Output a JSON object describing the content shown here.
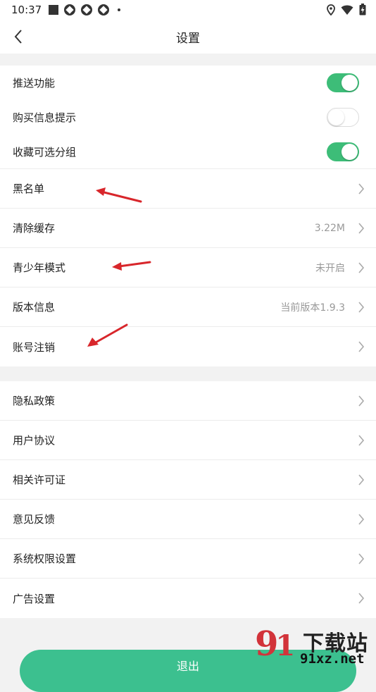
{
  "status_bar": {
    "time": "10:37",
    "icons_left": [
      "stop-square-icon",
      "app-icon",
      "app-icon",
      "app-icon",
      "dot-icon"
    ],
    "icons_right": [
      "location-icon",
      "wifi-icon",
      "battery-charging-icon"
    ]
  },
  "nav": {
    "title": "设置",
    "back_icon": "chevron-left-icon"
  },
  "toggles": [
    {
      "label": "推送功能",
      "on": true
    },
    {
      "label": "购买信息提示",
      "on": false
    },
    {
      "label": "收藏可选分组",
      "on": true
    }
  ],
  "group1": [
    {
      "label": "黑名单",
      "value": ""
    },
    {
      "label": "清除缓存",
      "value": "3.22M"
    },
    {
      "label": "青少年模式",
      "value": "未开启"
    },
    {
      "label": "版本信息",
      "value": "当前版本1.9.3"
    },
    {
      "label": "账号注销",
      "value": ""
    }
  ],
  "group2": [
    {
      "label": "隐私政策"
    },
    {
      "label": "用户协议"
    },
    {
      "label": "相关许可证"
    },
    {
      "label": "意见反馈"
    },
    {
      "label": "系统权限设置"
    },
    {
      "label": "广告设置"
    }
  ],
  "logout_label": "退出",
  "watermark": {
    "digits": "9",
    "site_name": "下载站",
    "url": "91xz.net"
  },
  "colors": {
    "accent_green": "#3dbd78",
    "logout_green": "#3cc08f",
    "annotation_red": "#d8262b"
  }
}
